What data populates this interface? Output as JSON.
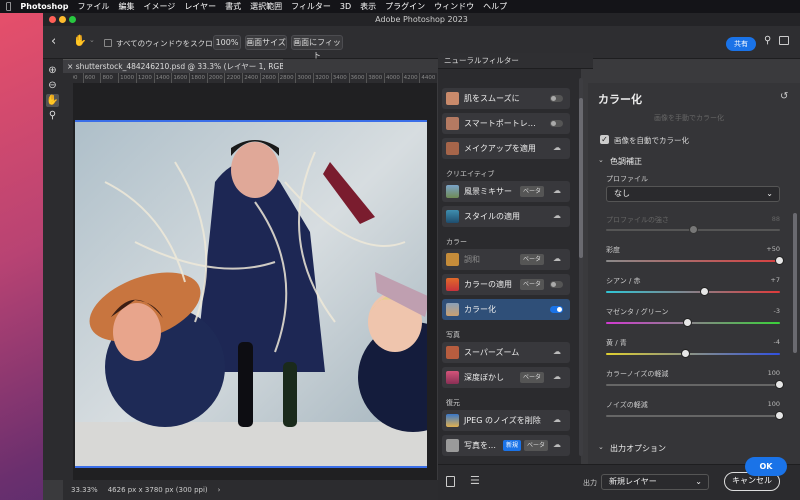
{
  "menubar": {
    "app": "Photoshop",
    "items": [
      "ファイル",
      "編集",
      "イメージ",
      "レイヤー",
      "書式",
      "選択範囲",
      "フィルター",
      "3D",
      "表示",
      "プラグイン",
      "ウィンドウ",
      "ヘルプ"
    ]
  },
  "window": {
    "title": "Adobe Photoshop 2023"
  },
  "options": {
    "scroll_all": "すべてのウィンドウをスクロール",
    "zoom": "100%",
    "screen_size": "画面サイズ",
    "fit_screen": "画面にフィット",
    "share": "共有"
  },
  "document": {
    "tab": "shutterstock_484246210.psd @ 33.3% (レイヤー 1, RGB/8#) *",
    "ruler_ticks": [
      "400",
      "600",
      "800",
      "1000",
      "1200",
      "1400",
      "1600",
      "1800",
      "2000",
      "2200",
      "2400",
      "2600",
      "2800",
      "3000",
      "3200",
      "3400",
      "3600",
      "3800",
      "4000",
      "4200",
      "4400"
    ],
    "status_zoom": "33.33%",
    "status_size": "4626 px x 3780 px (300 ppi)"
  },
  "neural": {
    "tab": "ニューラルフィルター",
    "groups": {
      "creative": "クリエイティブ",
      "color": "カラー",
      "photo": "写真",
      "restore": "復元"
    },
    "filters": {
      "smooth_skin": "肌をスムーズに",
      "smart_portrait": "スマートポートレ…",
      "makeup": "メイクアップを適用",
      "landscape": "風景ミキサー",
      "style": "スタイルの適用",
      "harmony": "調和",
      "color_transfer": "カラーの適用",
      "colorize": "カラー化",
      "super_zoom": "スーパーズーム",
      "depth_blur": "深度ぼかし",
      "jpeg": "JPEG のノイズを削除",
      "photo_restore": "写真を…"
    },
    "beta": "ベータ",
    "new": "新規"
  },
  "panel": {
    "title": "カラー化",
    "faded": "画像を手動でカラー化",
    "auto_colorize": "画像を自動でカラー化",
    "adjust_header": "色調補正",
    "profile_label": "プロファイル",
    "profile_value": "なし",
    "profile_strength": "プロファイルの強さ",
    "profile_strength_val": "88",
    "sliders": [
      {
        "label": "彩度",
        "value": "+50",
        "pos": 1.0
      },
      {
        "label": "シアン / 赤",
        "value": "+7",
        "pos": 0.57
      },
      {
        "label": "マゼンタ / グリーン",
        "value": "-3",
        "pos": 0.47
      },
      {
        "label": "黄 / 青",
        "value": "-4",
        "pos": 0.46
      },
      {
        "label": "カラーノイズの軽減",
        "value": "100",
        "pos": 1.0
      },
      {
        "label": "ノイズの軽減",
        "value": "100",
        "pos": 1.0
      }
    ],
    "output_options": "出力オプション"
  },
  "footer": {
    "output_label": "出力",
    "output_value": "新規レイヤー",
    "cancel": "キャンセル",
    "ok": "OK"
  }
}
